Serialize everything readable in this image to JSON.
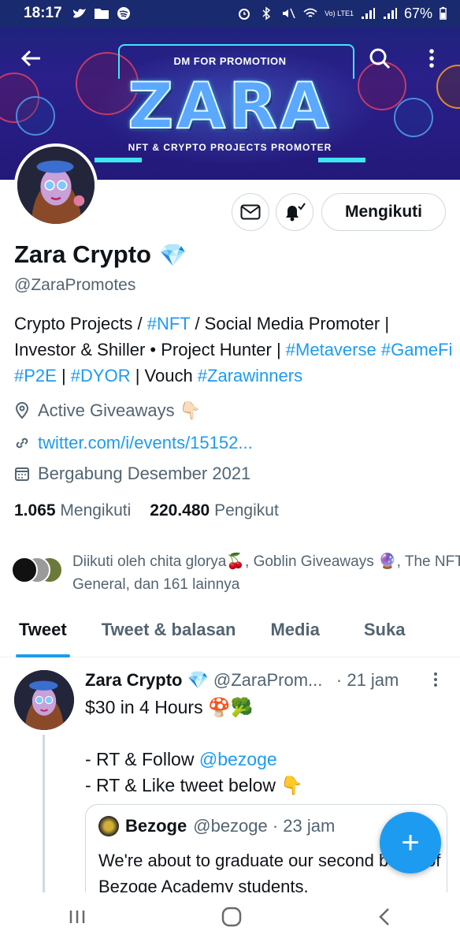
{
  "status_bar": {
    "time": "18:17",
    "battery": "67%",
    "network": "Vo) LTE1"
  },
  "banner": {
    "top_text": "DM FOR PROMOTION",
    "logo_text": "ZARA",
    "bottom_text": "NFT & CRYPTO PROJECTS PROMOTER"
  },
  "profile": {
    "name": "Zara Crypto",
    "name_emoji": "💎",
    "handle": "@ZaraPromotes",
    "follow_button": "Mengikuti",
    "bio_parts": [
      {
        "text": "Crypto Projects / ",
        "tag": false
      },
      {
        "text": "#NFT",
        "tag": true
      },
      {
        "text": " / Social Media Promoter | Investor & Shiller • Project Hunter | ",
        "tag": false
      },
      {
        "text": "#Metaverse",
        "tag": true
      },
      {
        "text": " ",
        "tag": false
      },
      {
        "text": "#GameFi",
        "tag": true
      },
      {
        "text": " ",
        "tag": false
      },
      {
        "text": "#P2E",
        "tag": true
      },
      {
        "text": " | ",
        "tag": false
      },
      {
        "text": "#DYOR",
        "tag": true
      },
      {
        "text": " | Vouch ",
        "tag": false
      },
      {
        "text": "#Zarawinners",
        "tag": true
      }
    ],
    "location": "Active Giveaways 👇🏻",
    "website": "twitter.com/i/events/15152...",
    "joined": "Bergabung Desember 2021",
    "following_count": "1.065",
    "following_label": "Mengikuti",
    "followers_count": "220.480",
    "followers_label": "Pengikut",
    "followed_by": "Diikuti oleh chita glorya🍒, Goblin Giveaways 🔮, The NFT General, dan 161 lainnya"
  },
  "tabs": [
    {
      "label": "Tweet",
      "active": true
    },
    {
      "label": "Tweet & balasan",
      "active": false
    },
    {
      "label": "Media",
      "active": false
    },
    {
      "label": "Suka",
      "active": false
    }
  ],
  "tweet": {
    "name": "Zara Crypto",
    "emoji": "💎",
    "handle": "@ZaraProm...",
    "time": "· 21 jam",
    "line1": "$30 in 4 Hours 🍄🥦",
    "line2_prefix": "- RT & Follow ",
    "line2_mention": "@bezoge",
    "line3": "- RT & Like tweet below 👇",
    "quote": {
      "name": "Bezoge",
      "handle": "@bezoge · 23 jam",
      "text": "We're about to graduate our second batch of Bezoge Academy students."
    }
  },
  "fab_label": "+",
  "nav": {
    "recents": "|||",
    "home": "○",
    "back": "<"
  }
}
